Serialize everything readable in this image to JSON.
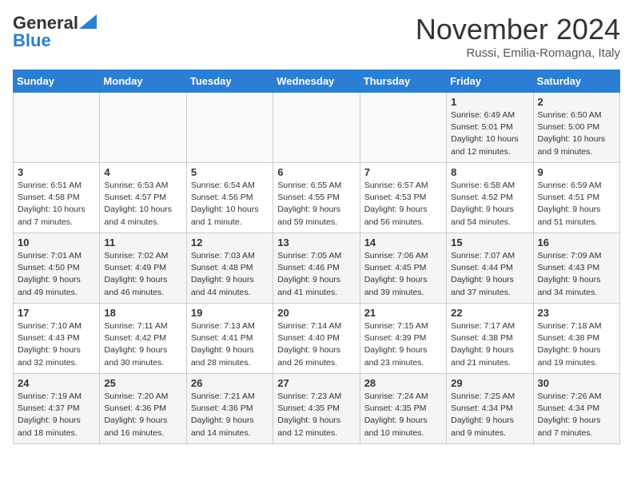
{
  "logo": {
    "line1": "General",
    "line2": "Blue"
  },
  "title": "November 2024",
  "location": "Russi, Emilia-Romagna, Italy",
  "days_header": [
    "Sunday",
    "Monday",
    "Tuesday",
    "Wednesday",
    "Thursday",
    "Friday",
    "Saturday"
  ],
  "weeks": [
    [
      {
        "num": "",
        "info": ""
      },
      {
        "num": "",
        "info": ""
      },
      {
        "num": "",
        "info": ""
      },
      {
        "num": "",
        "info": ""
      },
      {
        "num": "",
        "info": ""
      },
      {
        "num": "1",
        "info": "Sunrise: 6:49 AM\nSunset: 5:01 PM\nDaylight: 10 hours and 12 minutes."
      },
      {
        "num": "2",
        "info": "Sunrise: 6:50 AM\nSunset: 5:00 PM\nDaylight: 10 hours and 9 minutes."
      }
    ],
    [
      {
        "num": "3",
        "info": "Sunrise: 6:51 AM\nSunset: 4:58 PM\nDaylight: 10 hours and 7 minutes."
      },
      {
        "num": "4",
        "info": "Sunrise: 6:53 AM\nSunset: 4:57 PM\nDaylight: 10 hours and 4 minutes."
      },
      {
        "num": "5",
        "info": "Sunrise: 6:54 AM\nSunset: 4:56 PM\nDaylight: 10 hours and 1 minute."
      },
      {
        "num": "6",
        "info": "Sunrise: 6:55 AM\nSunset: 4:55 PM\nDaylight: 9 hours and 59 minutes."
      },
      {
        "num": "7",
        "info": "Sunrise: 6:57 AM\nSunset: 4:53 PM\nDaylight: 9 hours and 56 minutes."
      },
      {
        "num": "8",
        "info": "Sunrise: 6:58 AM\nSunset: 4:52 PM\nDaylight: 9 hours and 54 minutes."
      },
      {
        "num": "9",
        "info": "Sunrise: 6:59 AM\nSunset: 4:51 PM\nDaylight: 9 hours and 51 minutes."
      }
    ],
    [
      {
        "num": "10",
        "info": "Sunrise: 7:01 AM\nSunset: 4:50 PM\nDaylight: 9 hours and 49 minutes."
      },
      {
        "num": "11",
        "info": "Sunrise: 7:02 AM\nSunset: 4:49 PM\nDaylight: 9 hours and 46 minutes."
      },
      {
        "num": "12",
        "info": "Sunrise: 7:03 AM\nSunset: 4:48 PM\nDaylight: 9 hours and 44 minutes."
      },
      {
        "num": "13",
        "info": "Sunrise: 7:05 AM\nSunset: 4:46 PM\nDaylight: 9 hours and 41 minutes."
      },
      {
        "num": "14",
        "info": "Sunrise: 7:06 AM\nSunset: 4:45 PM\nDaylight: 9 hours and 39 minutes."
      },
      {
        "num": "15",
        "info": "Sunrise: 7:07 AM\nSunset: 4:44 PM\nDaylight: 9 hours and 37 minutes."
      },
      {
        "num": "16",
        "info": "Sunrise: 7:09 AM\nSunset: 4:43 PM\nDaylight: 9 hours and 34 minutes."
      }
    ],
    [
      {
        "num": "17",
        "info": "Sunrise: 7:10 AM\nSunset: 4:43 PM\nDaylight: 9 hours and 32 minutes."
      },
      {
        "num": "18",
        "info": "Sunrise: 7:11 AM\nSunset: 4:42 PM\nDaylight: 9 hours and 30 minutes."
      },
      {
        "num": "19",
        "info": "Sunrise: 7:13 AM\nSunset: 4:41 PM\nDaylight: 9 hours and 28 minutes."
      },
      {
        "num": "20",
        "info": "Sunrise: 7:14 AM\nSunset: 4:40 PM\nDaylight: 9 hours and 26 minutes."
      },
      {
        "num": "21",
        "info": "Sunrise: 7:15 AM\nSunset: 4:39 PM\nDaylight: 9 hours and 23 minutes."
      },
      {
        "num": "22",
        "info": "Sunrise: 7:17 AM\nSunset: 4:38 PM\nDaylight: 9 hours and 21 minutes."
      },
      {
        "num": "23",
        "info": "Sunrise: 7:18 AM\nSunset: 4:38 PM\nDaylight: 9 hours and 19 minutes."
      }
    ],
    [
      {
        "num": "24",
        "info": "Sunrise: 7:19 AM\nSunset: 4:37 PM\nDaylight: 9 hours and 18 minutes."
      },
      {
        "num": "25",
        "info": "Sunrise: 7:20 AM\nSunset: 4:36 PM\nDaylight: 9 hours and 16 minutes."
      },
      {
        "num": "26",
        "info": "Sunrise: 7:21 AM\nSunset: 4:36 PM\nDaylight: 9 hours and 14 minutes."
      },
      {
        "num": "27",
        "info": "Sunrise: 7:23 AM\nSunset: 4:35 PM\nDaylight: 9 hours and 12 minutes."
      },
      {
        "num": "28",
        "info": "Sunrise: 7:24 AM\nSunset: 4:35 PM\nDaylight: 9 hours and 10 minutes."
      },
      {
        "num": "29",
        "info": "Sunrise: 7:25 AM\nSunset: 4:34 PM\nDaylight: 9 hours and 9 minutes."
      },
      {
        "num": "30",
        "info": "Sunrise: 7:26 AM\nSunset: 4:34 PM\nDaylight: 9 hours and 7 minutes."
      }
    ]
  ]
}
